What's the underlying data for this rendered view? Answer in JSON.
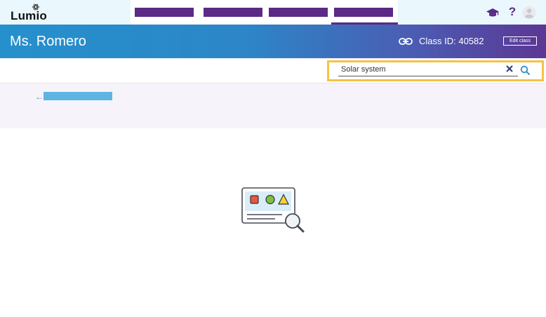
{
  "brand": {
    "logo_text": "Lumio"
  },
  "nav": {
    "tabs": [
      "",
      "",
      "",
      ""
    ],
    "icons": [
      "graduation-cap-icon",
      "help-icon",
      "user-avatar-icon"
    ],
    "help_label": "?"
  },
  "header": {
    "teacher_name": "Ms. Romero",
    "class_id_text": "Class ID: 40582",
    "edit_class_label": "Edit class"
  },
  "search": {
    "value": "Solar system"
  },
  "colors": {
    "accent_purple": "#5b2a86",
    "header_gradient_start": "#2590cc",
    "header_gradient_end": "#5b3794",
    "search_highlight": "#f6c244",
    "link_blue": "#5fb5e2"
  }
}
